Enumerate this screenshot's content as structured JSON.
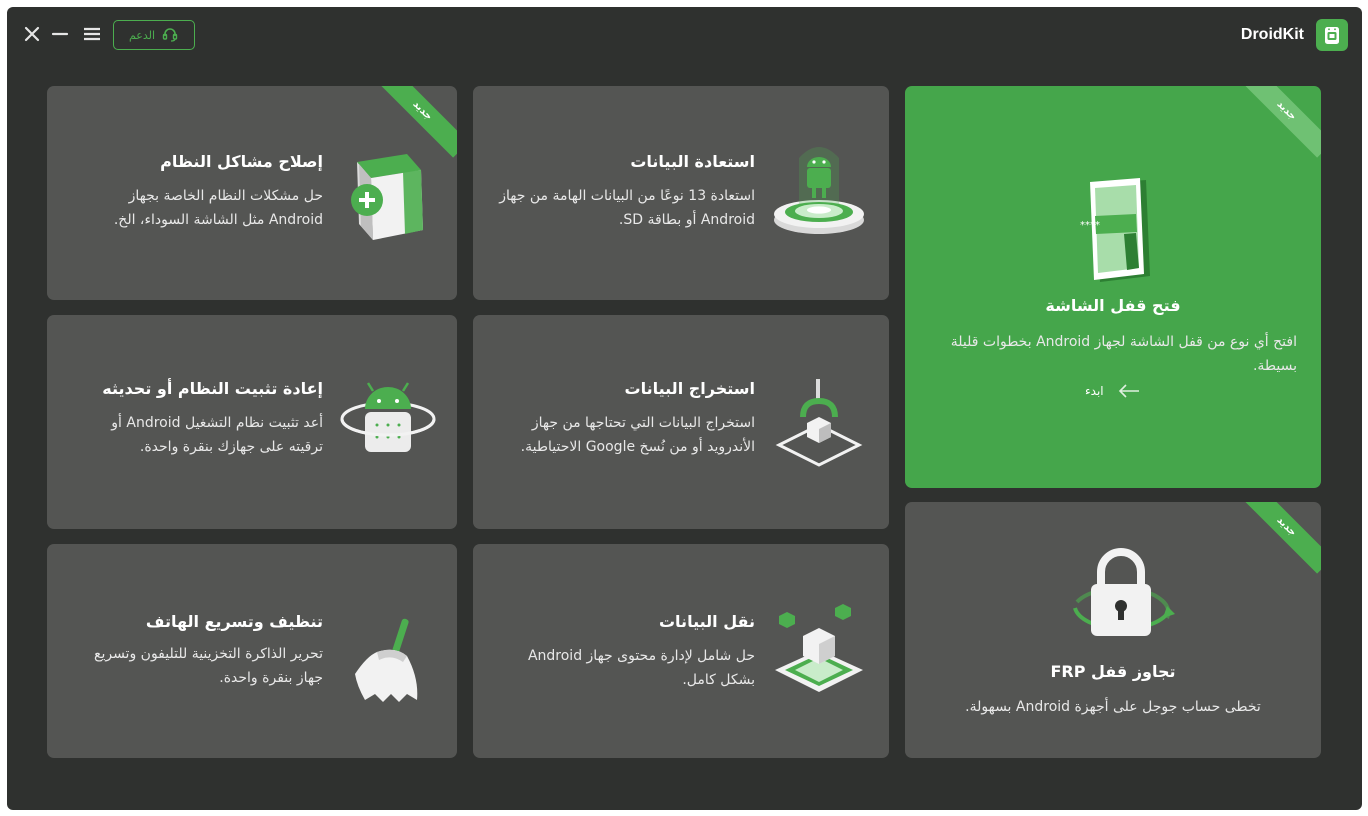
{
  "app": {
    "name": "DroidKit"
  },
  "toolbar": {
    "support_label": "الدعم"
  },
  "badge_new": "جديد",
  "cards": {
    "screen_unlock": {
      "title": "فتح قفل الشاشة",
      "desc": "افتح أي نوع من قفل الشاشة لجهاز Android بخطوات قليلة بسيطة.",
      "start": "ابدء"
    },
    "frp": {
      "title": "تجاوز قفل FRP",
      "desc": "تخطى حساب جوجل على أجهزة Android بسهولة."
    },
    "data_recovery": {
      "title": "استعادة البيانات",
      "desc": "استعادة 13 نوعًا من البيانات الهامة من جهاز Android أو بطاقة SD."
    },
    "system_fix": {
      "title": "إصلاح مشاكل النظام",
      "desc": "حل مشكلات النظام الخاصة بجهاز Android مثل الشاشة السوداء، الخ."
    },
    "data_extract": {
      "title": "استخراج البيانات",
      "desc": "استخراج البيانات التي تحتاجها من جهاز الأندرويد أو من نُسخ Google الاحتياطية."
    },
    "reinstall": {
      "title": "إعادة تثبيت النظام أو تحديثه",
      "desc": "أعد تثبيت نظام التشغيل Android أو ترقيته على جهازك بنقرة واحدة."
    },
    "data_transfer": {
      "title": "نقل البيانات",
      "desc": "حل شامل لإدارة محتوى جهاز Android بشكل كامل."
    },
    "cleaner": {
      "title": "تنظيف وتسريع الهاتف",
      "desc": "تحرير الذاكرة التخزينية للتليفون وتسريع جهاز بنقرة واحدة."
    }
  },
  "colors": {
    "accent": "#4cae4f",
    "bg": "#2f312f",
    "card": "#545553",
    "card_active": "#45a64b"
  }
}
